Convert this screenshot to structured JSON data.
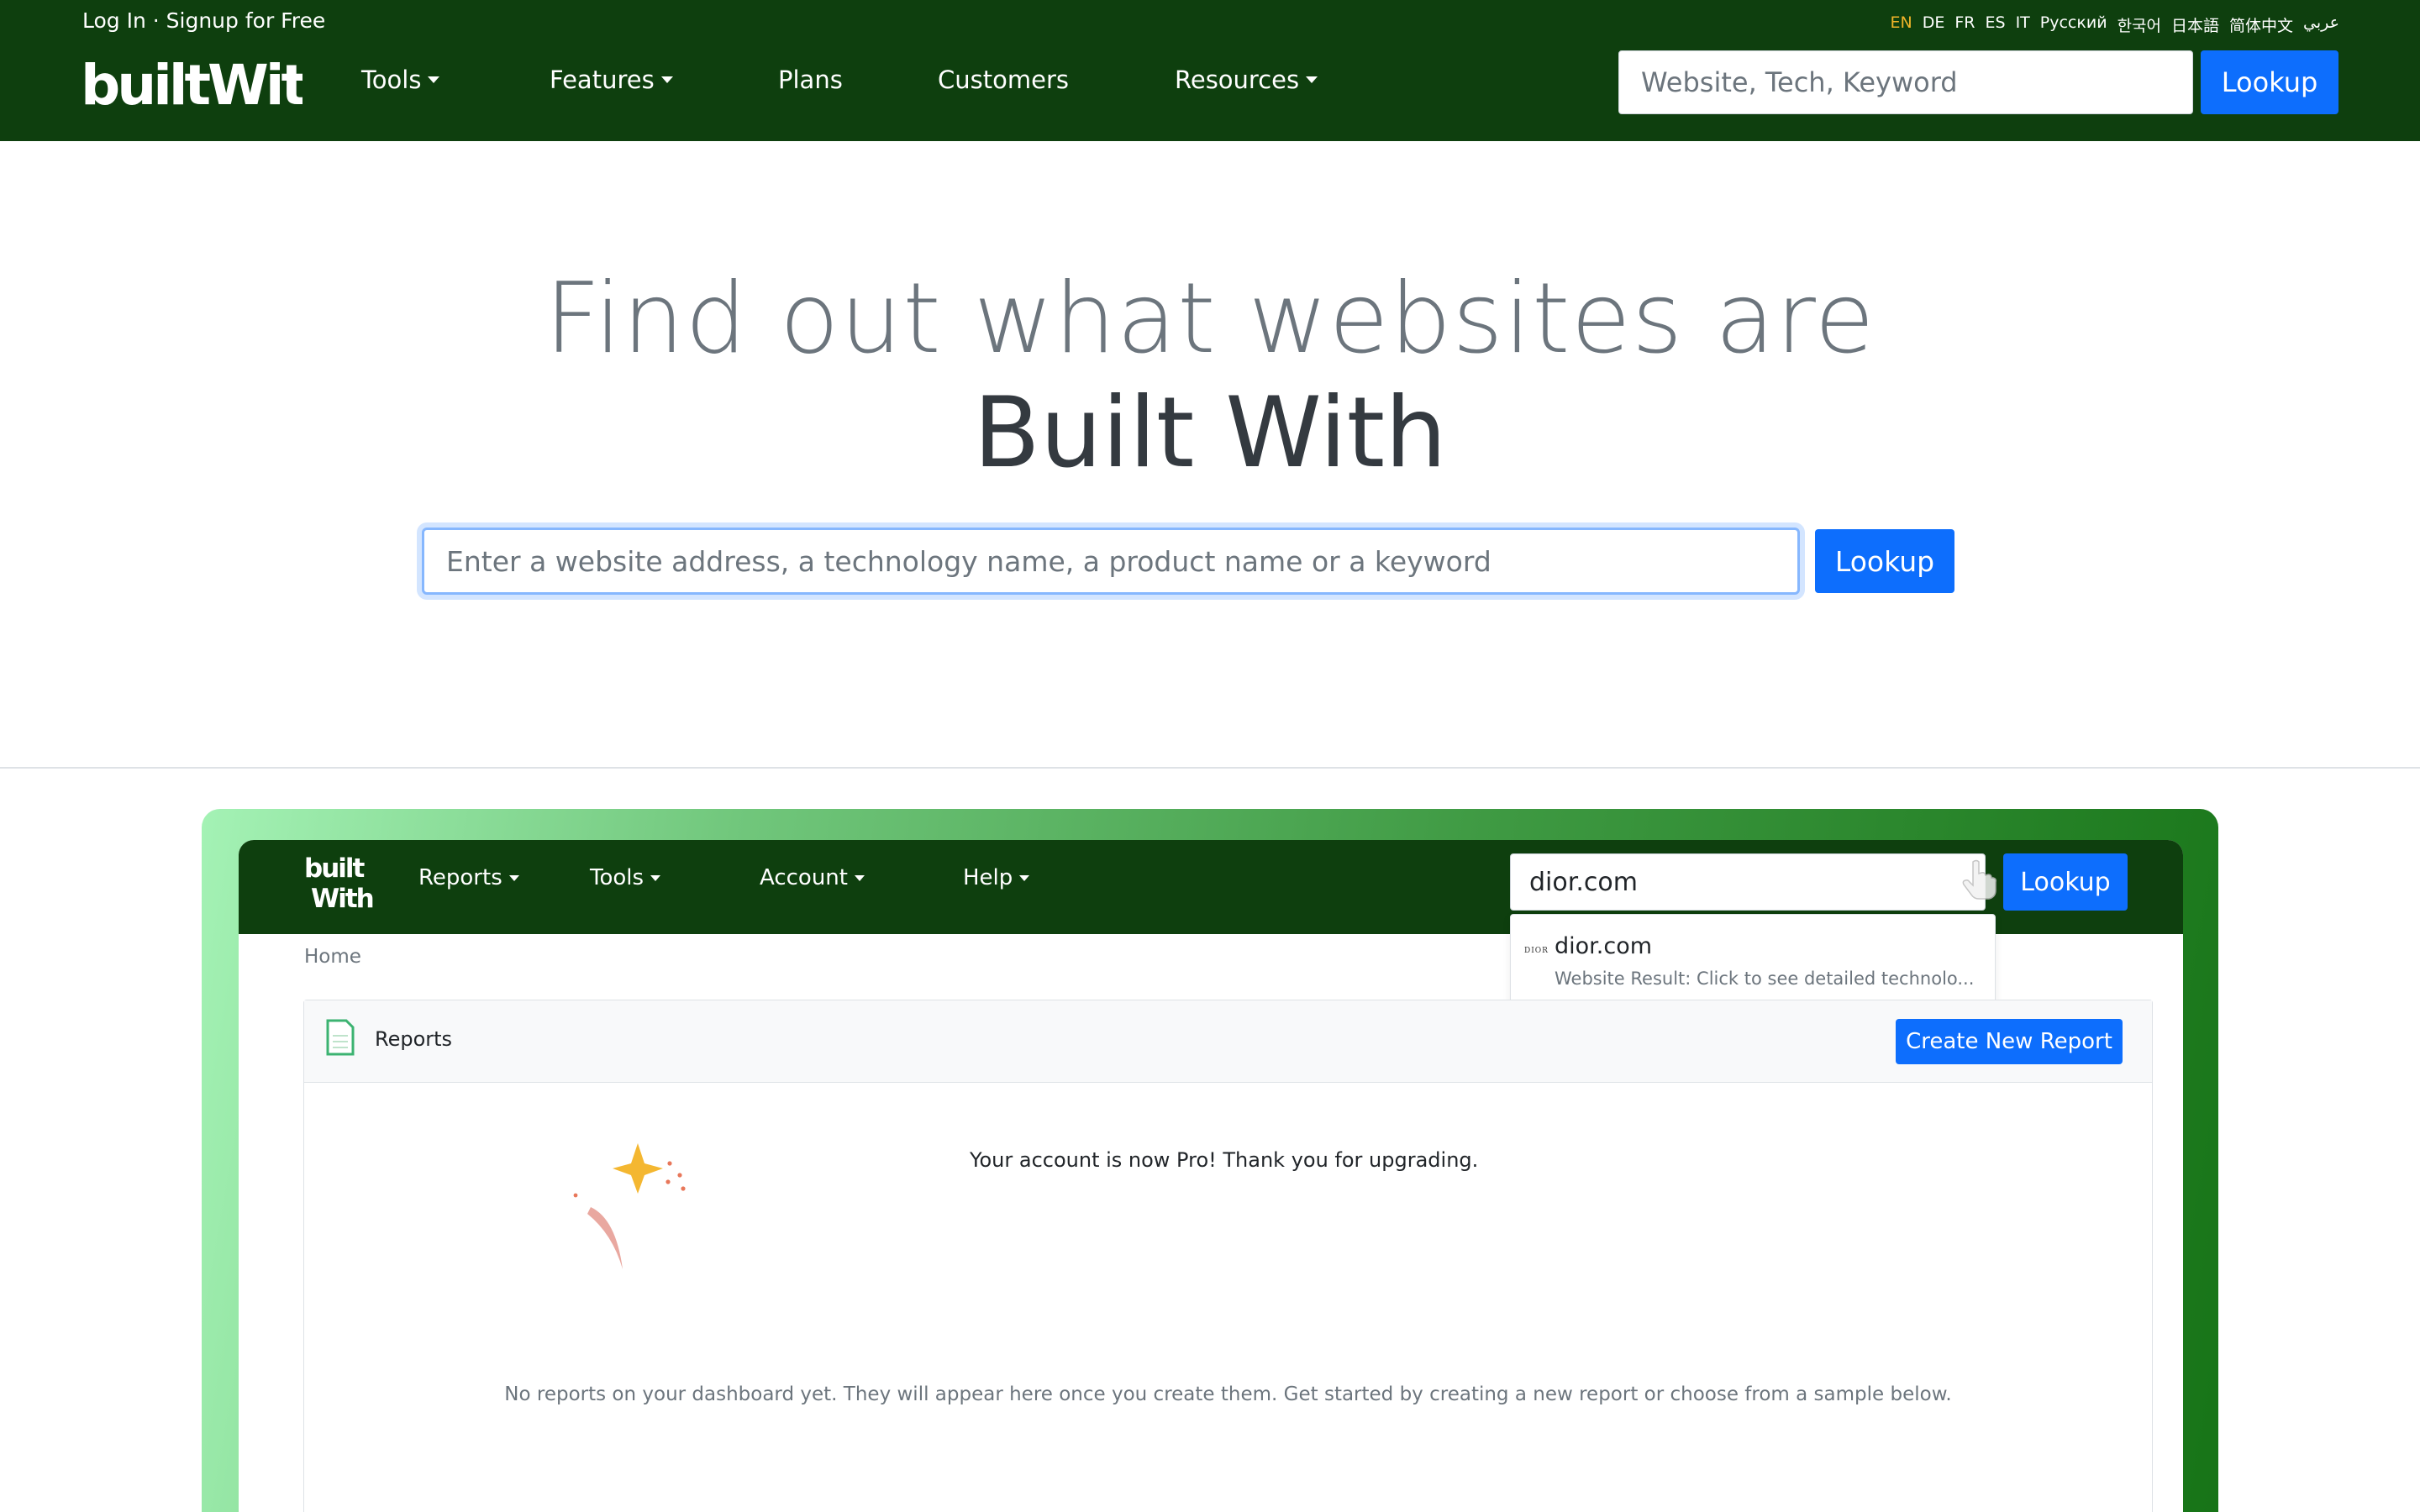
{
  "auth": {
    "text": "Log In · Signup for Free"
  },
  "languages": [
    {
      "code": "EN",
      "active": true
    },
    {
      "code": "DE",
      "active": false
    },
    {
      "code": "FR",
      "active": false
    },
    {
      "code": "ES",
      "active": false
    },
    {
      "code": "IT",
      "active": false
    },
    {
      "code": "Русский",
      "active": false
    },
    {
      "code": "한국어",
      "active": false
    },
    {
      "code": "日本語",
      "active": false
    },
    {
      "code": "简体中文",
      "active": false
    },
    {
      "code": "عربي",
      "active": false
    }
  ],
  "logo": {
    "text": "builtWith"
  },
  "nav": {
    "tools": "Tools",
    "features": "Features",
    "plans": "Plans",
    "customers": "Customers",
    "resources": "Resources"
  },
  "top_search": {
    "placeholder": "Website, Tech, Keyword",
    "button": "Lookup"
  },
  "hero": {
    "line1": "Find out what websites are",
    "line2": "Built With",
    "search_placeholder": "Enter a website address, a technology name, a product name or a keyword",
    "button": "Lookup"
  },
  "demo": {
    "logo_top": "built",
    "logo_bottom": "With",
    "nav": {
      "reports": "Reports",
      "tools": "Tools",
      "account": "Account",
      "help": "Help"
    },
    "search_value": "dior.com",
    "lookup_button": "Lookup",
    "dropdown": {
      "favicon_text": "DIOR",
      "title": "dior.com",
      "subtitle": "Website Result: Click to see detailed technolo..."
    },
    "breadcrumb": "Home",
    "reports_card": {
      "title": "Reports",
      "create_button": "Create New Report",
      "pro_message": "Your account is now Pro! Thank you for upgrading.",
      "empty_message": "No reports on your dashboard yet. They will appear here once you create them. Get started by creating a new report or choose from a sample below."
    }
  },
  "colors": {
    "nav_bg": "#0e3f0e",
    "primary": "#0d6efd",
    "active_lang": "#f0b429",
    "sparkle_star": "#f4b731",
    "sparkle_trail": "#e9a8a0"
  }
}
